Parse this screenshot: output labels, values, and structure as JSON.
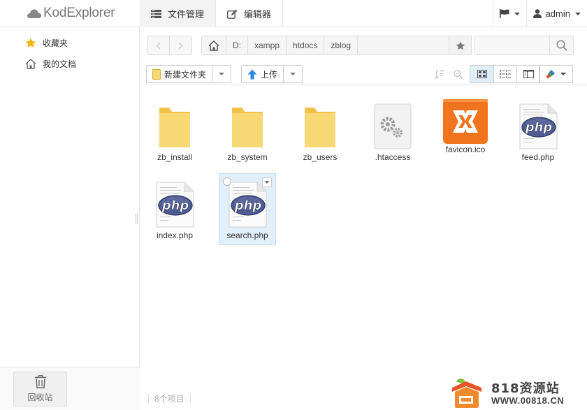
{
  "app": {
    "name": "KodExplorer"
  },
  "topnav": [
    {
      "label": "文件管理",
      "icon": "server-icon",
      "active": true
    },
    {
      "label": "编辑器",
      "icon": "edit-icon",
      "active": false
    }
  ],
  "topright": {
    "flag_icon": "flag-icon",
    "user": "admin"
  },
  "sidebar": {
    "items": [
      {
        "label": "收藏夹",
        "icon": "star-icon"
      },
      {
        "label": "我的文档",
        "icon": "home-icon"
      }
    ],
    "recycle_label": "回收站"
  },
  "address": {
    "crumbs": [
      "D:",
      "xampp",
      "htdocs",
      "zblog"
    ],
    "search_value": ""
  },
  "toolbar": {
    "new_folder": "新建文件夹",
    "upload": "上传"
  },
  "files": [
    {
      "name": "zb_install",
      "type": "folder"
    },
    {
      "name": "zb_system",
      "type": "folder"
    },
    {
      "name": "zb_users",
      "type": "folder"
    },
    {
      "name": ".htaccess",
      "type": "config"
    },
    {
      "name": "favicon.ico",
      "type": "xampp-ico"
    },
    {
      "name": "feed.php",
      "type": "php"
    },
    {
      "name": "index.php",
      "type": "php"
    },
    {
      "name": "search.php",
      "type": "php",
      "selected": true
    }
  ],
  "status": {
    "count": "8个项目"
  },
  "watermark": {
    "title": "818资源站",
    "url": "WWW.00818.CN"
  },
  "colors": {
    "accent": "#1b7dd6",
    "folder": "#f8d775",
    "xampp": "#f0731e",
    "php": "#4f5b93",
    "selected_bg": "#e2eff9"
  }
}
